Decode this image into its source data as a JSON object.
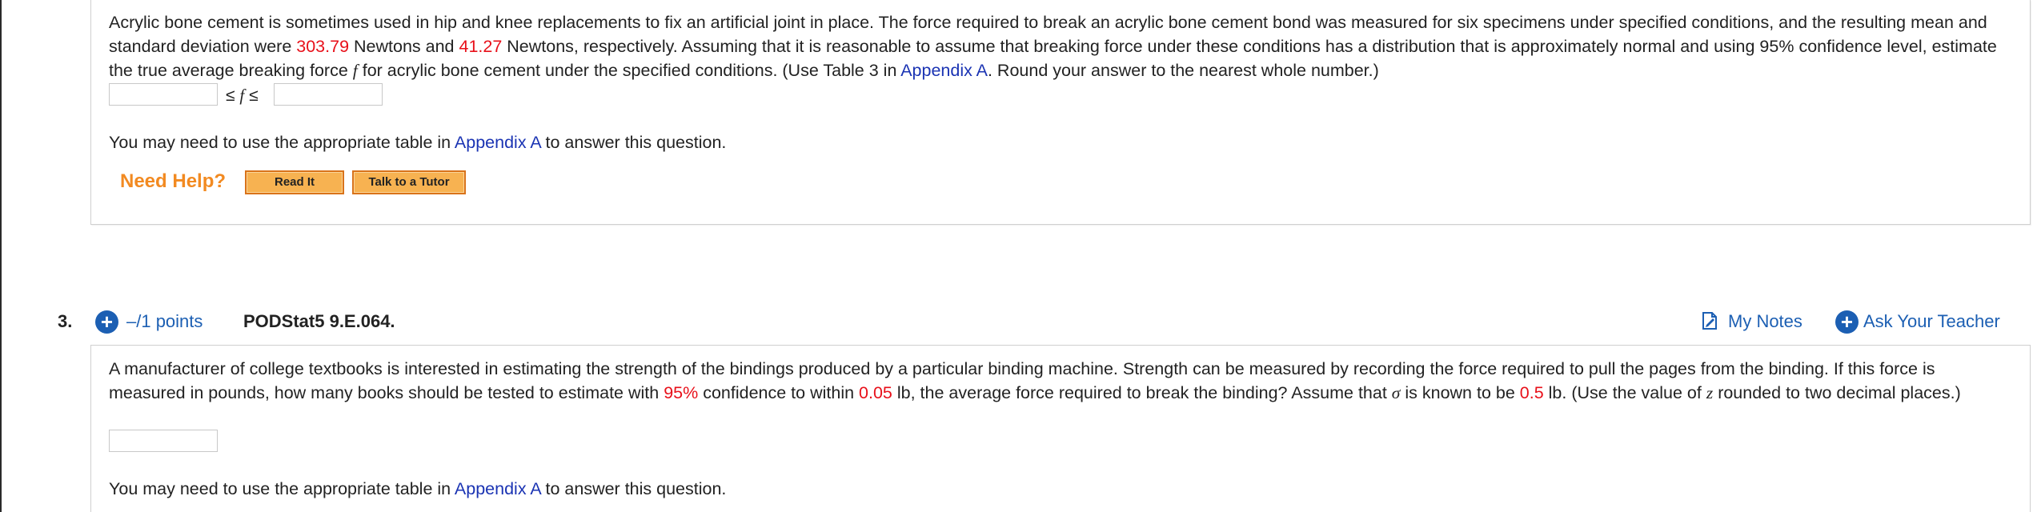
{
  "q2": {
    "text_before_mean": "Acrylic bone cement is sometimes used in hip and knee replacements to fix an artificial joint in place. The force required to break an acrylic bone cement bond was measured for six specimens under specified conditions, and the resulting mean and standard deviation were ",
    "mean": "303.79",
    "text_mid": " Newtons and ",
    "sd": "41.27",
    "text_after_sd": " Newtons, respectively. Assuming that it is reasonable to assume that breaking force under these conditions has a distribution that is approximately normal and using 95% confidence level, estimate the true average breaking force ",
    "var_f": "f",
    "text_after_f": " for acrylic bone cement under the specified conditions. (Use Table 3 in ",
    "appendix_link": "Appendix A",
    "text_end": ". Round your answer to the nearest whole number.)",
    "inequality": {
      "le1": "≤",
      "var": "f",
      "le2": "≤",
      "lower_value": "",
      "upper_value": ""
    },
    "helper_before": "You may need to use the appropriate table in ",
    "helper_link": "Appendix A",
    "helper_after": " to answer this question.",
    "need_help_label": "Need Help?",
    "read_it_label": "Read It",
    "tutor_label": "Talk to a Tutor"
  },
  "q3": {
    "number": "3.",
    "points": "–/1 points",
    "code": "PODStat5 9.E.064.",
    "my_notes": "My Notes",
    "ask_teacher": "Ask Your Teacher",
    "text_1": "A manufacturer of college textbooks is interested in estimating the strength of the bindings produced by a particular binding machine. Strength can be measured by recording the force required to pull the pages from the binding. If this force is measured in pounds, how many books should be tested to estimate with ",
    "conf": "95%",
    "text_2": " confidence to within ",
    "within": "0.05",
    "text_3": " lb, the average force required to break the binding? Assume that ",
    "sigma": "σ",
    "text_4": " is known to be ",
    "sigma_value": "0.5",
    "text_5": " lb. (Use the value of ",
    "var_z": "z",
    "text_6": " rounded to two decimal places.)",
    "answer_value": "",
    "helper_before": "You may need to use the appropriate table in ",
    "helper_link": "Appendix A",
    "helper_after": " to answer this question."
  },
  "colors": {
    "highlight": "#e8101a",
    "link": "#1a33b3",
    "accent_blue": "#1c5fb3",
    "need_help": "#f28a21",
    "button_fill": "#f7b251"
  }
}
